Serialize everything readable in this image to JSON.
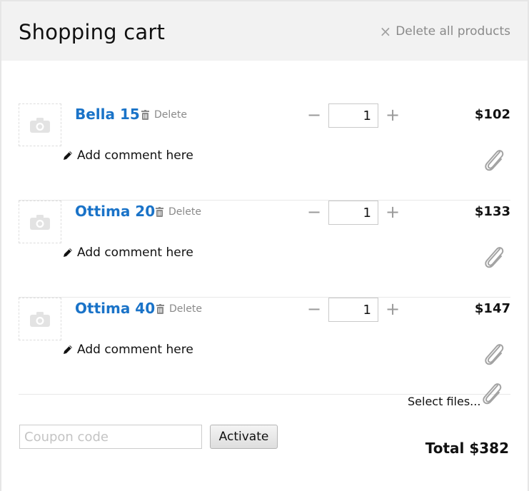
{
  "header": {
    "title": "Shopping cart",
    "delete_all_label": "Delete all products"
  },
  "items": [
    {
      "name": "Bella 15",
      "delete_label": "Delete",
      "quantity": "1",
      "price": "$102",
      "comment_label": "Add comment here"
    },
    {
      "name": "Ottima 20",
      "delete_label": "Delete",
      "quantity": "1",
      "price": "$133",
      "comment_label": "Add comment here"
    },
    {
      "name": "Ottima 40",
      "delete_label": "Delete",
      "quantity": "1",
      "price": "$147",
      "comment_label": "Add comment here"
    }
  ],
  "attachments": {
    "select_files_label": "Select files..."
  },
  "coupon": {
    "placeholder": "Coupon code",
    "value": "",
    "activate_label": "Activate"
  },
  "summary": {
    "total_label": "Total $382"
  },
  "icons": {
    "remove": "close-icon",
    "delete": "trash-icon",
    "decrease": "minus-icon",
    "increase": "plus-icon",
    "comment": "pencil-icon",
    "attach": "paperclip-icon",
    "thumbnail": "camera-icon"
  },
  "colors": {
    "header_bg": "#f2f2f2",
    "product_link": "#1a73c8",
    "muted_text": "#8a8a8a"
  }
}
